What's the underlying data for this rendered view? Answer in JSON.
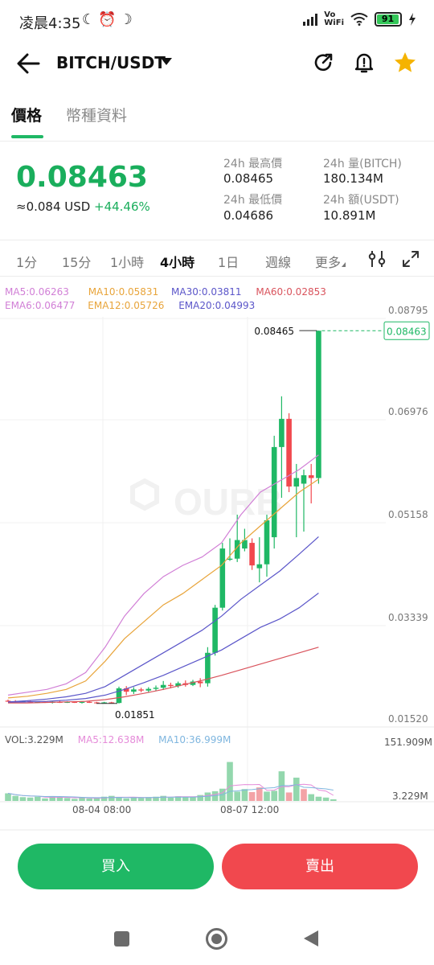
{
  "status_bar": {
    "time": "凌晨4:35",
    "vowifi_top": "Vo",
    "vowifi_bottom": "WiFi",
    "battery": "91"
  },
  "header": {
    "pair": "BITCH/USDT"
  },
  "tabs": [
    {
      "label": "價格"
    },
    {
      "label": "幣種資料"
    }
  ],
  "ticker": {
    "last_price": "0.08463",
    "usd_approx": "≈0.084 USD",
    "change": "+44.46%",
    "stats": [
      {
        "label": "24h 最高價",
        "value": "0.08465"
      },
      {
        "label": "24h 量(BITCH)",
        "value": "180.134M"
      },
      {
        "label": "24h 最低價",
        "value": "0.04686"
      },
      {
        "label": "24h 額(USDT)",
        "value": "10.891M"
      }
    ]
  },
  "intervals": [
    {
      "label": "1分"
    },
    {
      "label": "15分"
    },
    {
      "label": "1小時"
    },
    {
      "label": "4小時"
    },
    {
      "label": "1日"
    },
    {
      "label": "週線"
    },
    {
      "label": "更多"
    }
  ],
  "indicators": {
    "row1": [
      {
        "text": "MA5:0.06263",
        "color": "#d17fd6"
      },
      {
        "text": "MA10:0.05831",
        "color": "#e8a43a"
      },
      {
        "text": "MA30:0.03811",
        "color": "#5b56c9"
      },
      {
        "text": "MA60:0.02853",
        "color": "#d9535c"
      }
    ],
    "row2": [
      {
        "text": "EMA6:0.06477",
        "color": "#d17fd6"
      },
      {
        "text": "EMA12:0.05726",
        "color": "#e8a43a"
      },
      {
        "text": "EMA20:0.04993",
        "color": "#5b56c9"
      }
    ]
  },
  "chart_data": {
    "type": "candlestick",
    "price_axis": [
      "0.08795",
      "0.06976",
      "0.05158",
      "0.03339",
      "0.01520"
    ],
    "y_range": [
      0.0152,
      0.08795
    ],
    "high_label": "0.08465",
    "low_label": "0.01851",
    "current_price": "0.08463",
    "time_labels": [
      "08-04 08:00",
      "08-07 12:00"
    ],
    "candles": [
      {
        "o": 0.019,
        "h": 0.0192,
        "l": 0.0188,
        "c": 0.0189
      },
      {
        "o": 0.0189,
        "h": 0.0191,
        "l": 0.0187,
        "c": 0.0188
      },
      {
        "o": 0.0188,
        "h": 0.019,
        "l": 0.0187,
        "c": 0.0189
      },
      {
        "o": 0.0189,
        "h": 0.019,
        "l": 0.0186,
        "c": 0.0187
      },
      {
        "o": 0.0187,
        "h": 0.0189,
        "l": 0.0186,
        "c": 0.0188
      },
      {
        "o": 0.0188,
        "h": 0.0189,
        "l": 0.0186,
        "c": 0.0187
      },
      {
        "o": 0.0187,
        "h": 0.0189,
        "l": 0.0185,
        "c": 0.0188
      },
      {
        "o": 0.0188,
        "h": 0.019,
        "l": 0.0186,
        "c": 0.0187
      },
      {
        "o": 0.0187,
        "h": 0.0189,
        "l": 0.0186,
        "c": 0.0188
      },
      {
        "o": 0.0188,
        "h": 0.0189,
        "l": 0.0186,
        "c": 0.0187
      },
      {
        "o": 0.0187,
        "h": 0.0189,
        "l": 0.0185,
        "c": 0.0188
      },
      {
        "o": 0.0188,
        "h": 0.0189,
        "l": 0.0186,
        "c": 0.0187
      },
      {
        "o": 0.0187,
        "h": 0.0188,
        "l": 0.0185,
        "c": 0.0186
      },
      {
        "o": 0.0186,
        "h": 0.0188,
        "l": 0.0185,
        "c": 0.0187
      },
      {
        "o": 0.0187,
        "h": 0.0188,
        "l": 0.01851,
        "c": 0.0186
      },
      {
        "o": 0.0186,
        "h": 0.0215,
        "l": 0.01851,
        "c": 0.0212
      },
      {
        "o": 0.0212,
        "h": 0.0216,
        "l": 0.02,
        "c": 0.0206
      },
      {
        "o": 0.0206,
        "h": 0.0214,
        "l": 0.0202,
        "c": 0.021
      },
      {
        "o": 0.021,
        "h": 0.0213,
        "l": 0.0205,
        "c": 0.0208
      },
      {
        "o": 0.0208,
        "h": 0.0214,
        "l": 0.0204,
        "c": 0.0211
      },
      {
        "o": 0.0211,
        "h": 0.0217,
        "l": 0.0207,
        "c": 0.0213
      },
      {
        "o": 0.0213,
        "h": 0.0225,
        "l": 0.0209,
        "c": 0.0218
      },
      {
        "o": 0.0218,
        "h": 0.0222,
        "l": 0.0212,
        "c": 0.0216
      },
      {
        "o": 0.0216,
        "h": 0.0224,
        "l": 0.0213,
        "c": 0.0221
      },
      {
        "o": 0.0221,
        "h": 0.0226,
        "l": 0.0215,
        "c": 0.0218
      },
      {
        "o": 0.0218,
        "h": 0.0227,
        "l": 0.0216,
        "c": 0.0224
      },
      {
        "o": 0.0224,
        "h": 0.023,
        "l": 0.0214,
        "c": 0.0221
      },
      {
        "o": 0.0221,
        "h": 0.0285,
        "l": 0.0215,
        "c": 0.0275
      },
      {
        "o": 0.0275,
        "h": 0.036,
        "l": 0.027,
        "c": 0.0355
      },
      {
        "o": 0.0355,
        "h": 0.047,
        "l": 0.035,
        "c": 0.046
      },
      {
        "o": 0.044,
        "h": 0.0478,
        "l": 0.0438,
        "c": 0.0442
      },
      {
        "o": 0.0442,
        "h": 0.052,
        "l": 0.0436,
        "c": 0.0475
      },
      {
        "o": 0.046,
        "h": 0.0495,
        "l": 0.0455,
        "c": 0.0475
      },
      {
        "o": 0.047,
        "h": 0.0478,
        "l": 0.0422,
        "c": 0.043
      },
      {
        "o": 0.0425,
        "h": 0.048,
        "l": 0.04,
        "c": 0.0432
      },
      {
        "o": 0.0432,
        "h": 0.052,
        "l": 0.041,
        "c": 0.051
      },
      {
        "o": 0.048,
        "h": 0.066,
        "l": 0.046,
        "c": 0.064
      },
      {
        "o": 0.064,
        "h": 0.073,
        "l": 0.055,
        "c": 0.069
      },
      {
        "o": 0.069,
        "h": 0.07,
        "l": 0.056,
        "c": 0.057
      },
      {
        "o": 0.057,
        "h": 0.061,
        "l": 0.048,
        "c": 0.0585
      },
      {
        "o": 0.0575,
        "h": 0.06,
        "l": 0.049,
        "c": 0.059
      },
      {
        "o": 0.059,
        "h": 0.061,
        "l": 0.054,
        "c": 0.0585
      },
      {
        "o": 0.0585,
        "h": 0.08465,
        "l": 0.0575,
        "c": 0.08463
      }
    ],
    "ma_lines": [
      {
        "color": "#d17fd6",
        "values": [
          0.02,
          0.0205,
          0.021,
          0.022,
          0.024,
          0.0285,
          0.034,
          0.038,
          0.041,
          0.043,
          0.0445,
          0.047,
          0.052,
          0.056,
          0.058,
          0.06,
          0.0626
        ]
      },
      {
        "color": "#e8a43a",
        "values": [
          0.0195,
          0.0198,
          0.0203,
          0.021,
          0.0225,
          0.026,
          0.03,
          0.033,
          0.036,
          0.038,
          0.0405,
          0.043,
          0.047,
          0.05,
          0.053,
          0.056,
          0.0583
        ]
      },
      {
        "color": "#5b56c9",
        "values": [
          0.0188,
          0.019,
          0.0193,
          0.0197,
          0.0203,
          0.0215,
          0.0235,
          0.0255,
          0.0275,
          0.0295,
          0.0315,
          0.034,
          0.037,
          0.0395,
          0.042,
          0.045,
          0.0481
        ]
      },
      {
        "color": "#5b56c9",
        "values": [
          0.0187,
          0.0188,
          0.0189,
          0.0191,
          0.0194,
          0.02,
          0.021,
          0.0222,
          0.0235,
          0.025,
          0.0265,
          0.028,
          0.03,
          0.032,
          0.0335,
          0.0355,
          0.0381
        ]
      },
      {
        "color": "#d9535c",
        "values": [
          0.0186,
          0.0186,
          0.0187,
          0.0188,
          0.0189,
          0.0192,
          0.0197,
          0.0203,
          0.021,
          0.0218,
          0.0226,
          0.0235,
          0.0245,
          0.0255,
          0.0265,
          0.0275,
          0.0285
        ]
      }
    ],
    "volume": {
      "labels": {
        "vol": "VOL:3.229M",
        "ma5": "MA5:12.638M",
        "ma10": "MA10:36.999M"
      },
      "colors": {
        "ma5": "#e58bd9",
        "ma10": "#7fb6df"
      },
      "axis_top": "151.909M",
      "axis_bottom": "3.229M",
      "bars": [
        18,
        12,
        9,
        8,
        10,
        6,
        11,
        9,
        7,
        5,
        8,
        6,
        7,
        10,
        12,
        9,
        6,
        8,
        7,
        9,
        10,
        12,
        8,
        11,
        9,
        10,
        14,
        20,
        23,
        29,
        92,
        22,
        28,
        21,
        32,
        22,
        24,
        70,
        20,
        55,
        28,
        16,
        10,
        8,
        4
      ],
      "up": [
        1,
        1,
        1,
        1,
        1,
        1,
        1,
        1,
        1,
        1,
        1,
        1,
        1,
        1,
        1,
        1,
        1,
        1,
        1,
        1,
        1,
        1,
        1,
        1,
        1,
        1,
        1,
        1,
        1,
        1,
        1,
        1,
        1,
        0,
        0,
        1,
        1,
        1,
        0,
        1,
        0,
        1,
        1,
        1,
        1
      ],
      "max": 151.909
    }
  },
  "actions": {
    "buy": "買入",
    "sell": "賣出"
  }
}
